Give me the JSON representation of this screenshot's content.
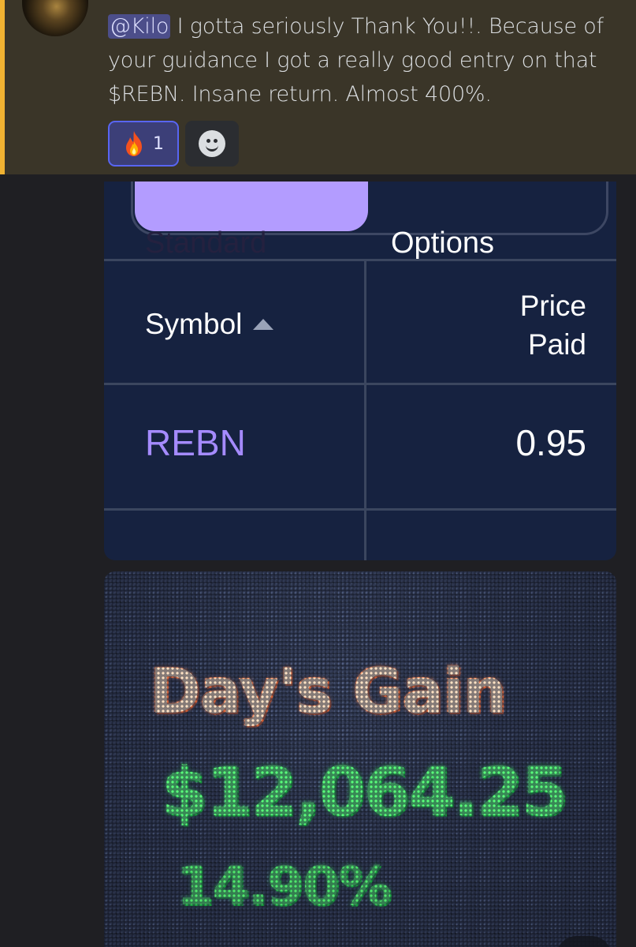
{
  "message": {
    "mention": "@Kilo",
    "line1_rest": " I gotta seriously Thank You!!. Because of",
    "line2": "your guidance I got a really good entry on that",
    "line3": "$REBN. Insane return. Almost 400%."
  },
  "reactions": [
    {
      "icon": "fire-emoji",
      "count": "1"
    },
    {
      "icon": "add-reaction-smiley-icon",
      "count": ""
    }
  ],
  "attachment_table": {
    "tabs": [
      "Standard",
      "Options"
    ],
    "active_tab": "Standard",
    "columns": {
      "symbol": "Symbol",
      "price_line1": "Price",
      "price_line2": "Paid"
    },
    "rows": [
      {
        "symbol": "REBN",
        "price_paid": "0.95"
      }
    ]
  },
  "attachment_photo": {
    "label": "Day's Gain",
    "value": "$12,064.25",
    "percent": "14.90%"
  },
  "colors": {
    "mention_bar": "#f0b232",
    "message_bg": "#3a3528",
    "table_bg": "#162240",
    "tab_active": "#b39cff",
    "symbol_link": "#a58bff",
    "gain_green": "#59ff7a"
  }
}
